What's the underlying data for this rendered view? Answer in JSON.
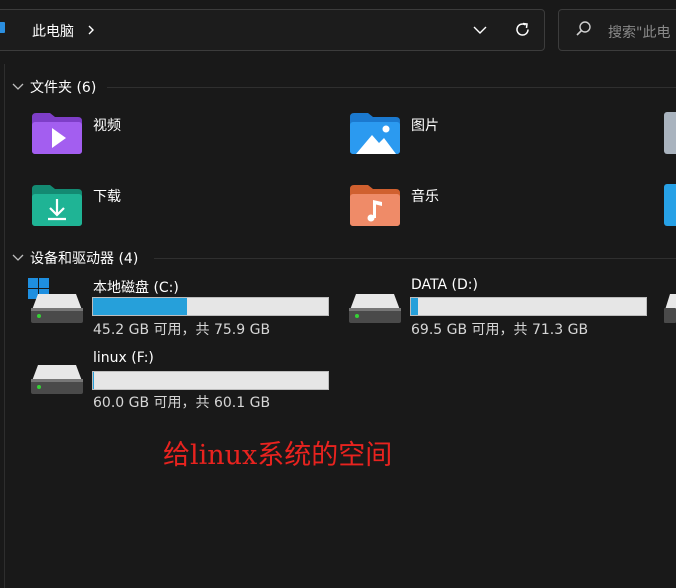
{
  "address": {
    "path_label": "此电脑",
    "search_placeholder": "搜索\"此电"
  },
  "sections": {
    "folders": {
      "title": "文件夹 (6)"
    },
    "drives": {
      "title": "设备和驱动器 (4)"
    }
  },
  "folders": [
    {
      "name": "视频"
    },
    {
      "name": "图片"
    },
    {
      "name": "下载"
    },
    {
      "name": "音乐"
    }
  ],
  "drives": [
    {
      "name": "本地磁盘 (C:)",
      "caption": "45.2 GB 可用，共 75.9 GB",
      "used_fraction": 0.4
    },
    {
      "name": "DATA (D:)",
      "caption": "69.5 GB 可用，共 71.3 GB",
      "used_fraction": 0.03
    },
    {
      "name": "linux (F:)",
      "caption": "60.0 GB 可用，共 60.1 GB",
      "used_fraction": 0.002
    }
  ],
  "annotation": {
    "text": "给linux系统的空间"
  },
  "colors": {
    "accent": "#26a0da",
    "annotation": "#e8231f"
  }
}
